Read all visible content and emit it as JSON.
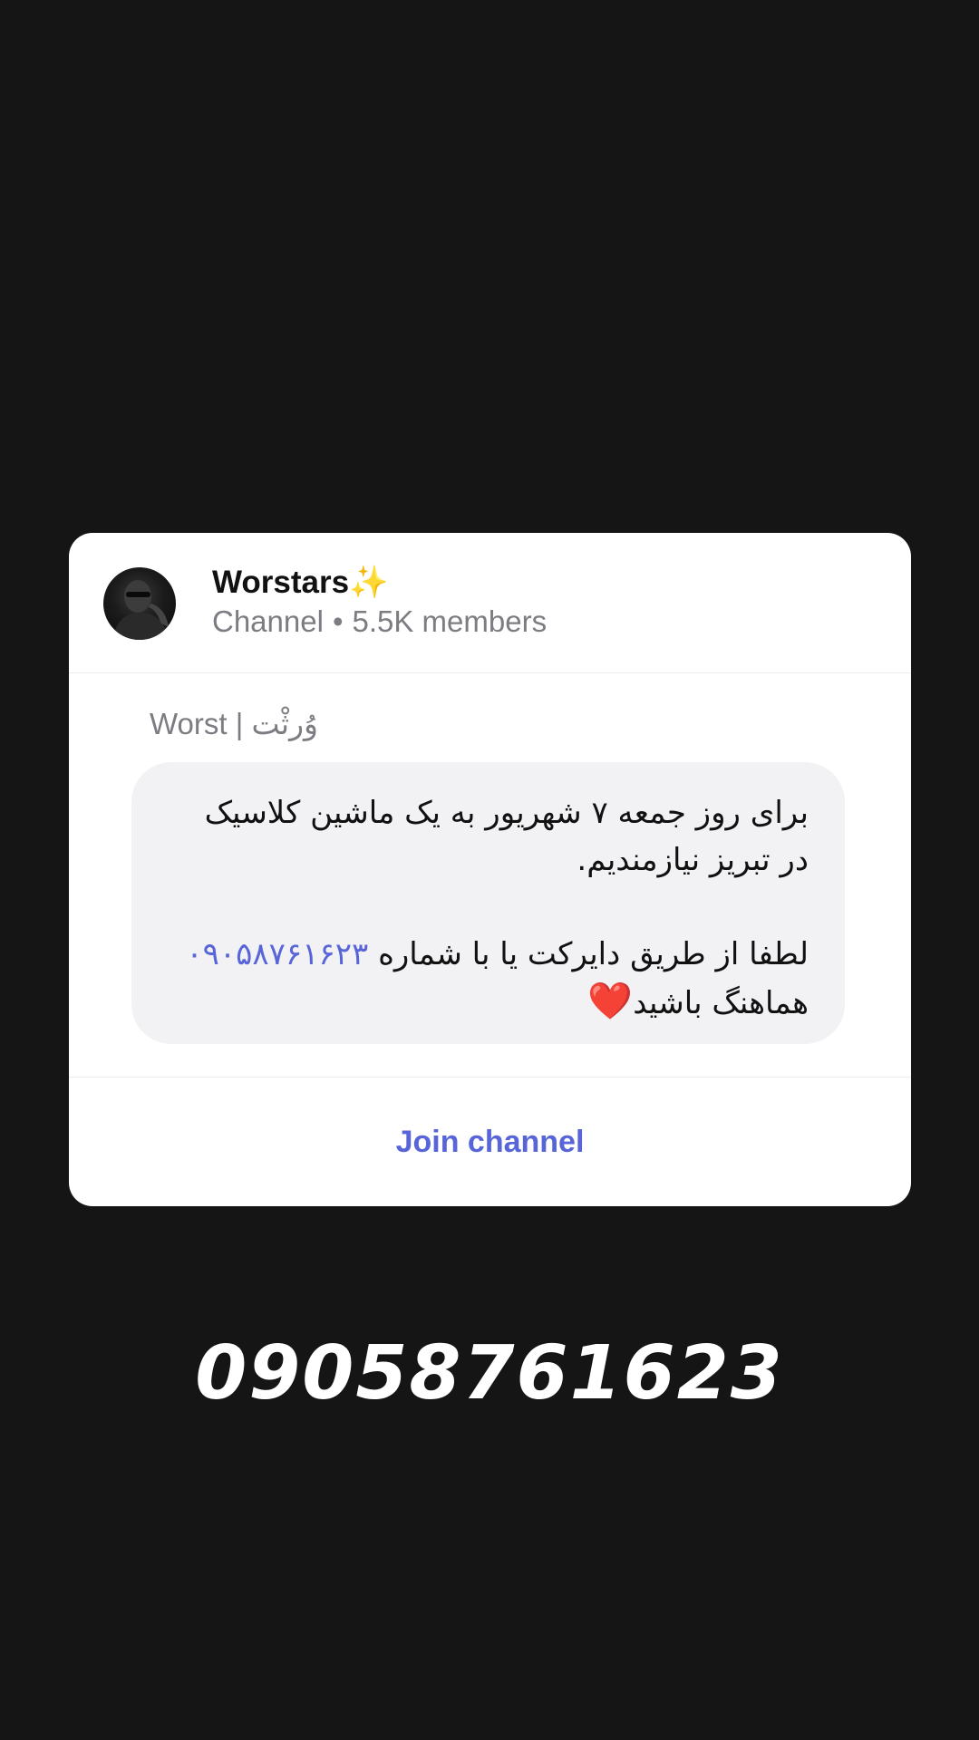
{
  "card": {
    "channel_name": "Worstars",
    "channel_sparkle": "✨",
    "channel_type": "Channel",
    "separator": "•",
    "member_count": "5.5K members",
    "sender": "Worst | وُرثْت",
    "message": {
      "line1": "برای روز جمعه ۷ شهریور به یک ماشین کلاسیک",
      "line2": "در تبریز نیازمندیم.",
      "line3_prefix": "لطفا از طریق دایرکت یا با شماره ",
      "phone": "۰۹۰۵۸۷۶۱۶۲۳",
      "line4": "هماهنگ باشید",
      "heart": "❤️"
    },
    "join_label": "Join channel"
  },
  "overlay_phone": "09058761623",
  "colors": {
    "background": "#151516",
    "card": "#ffffff",
    "bubble": "#f2f2f4",
    "accent": "#5865d8"
  }
}
